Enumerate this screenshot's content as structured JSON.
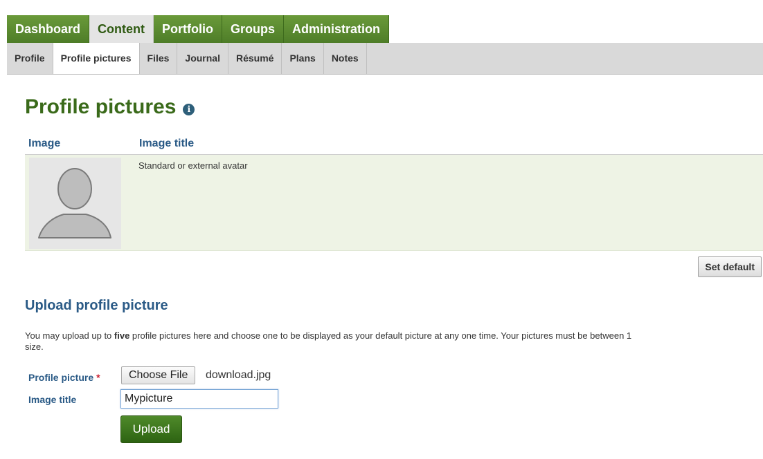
{
  "nav": {
    "main_tabs": [
      "Dashboard",
      "Content",
      "Portfolio",
      "Groups",
      "Administration"
    ],
    "main_selected": "Content",
    "sub_tabs": [
      "Profile",
      "Profile pictures",
      "Files",
      "Journal",
      "Résumé",
      "Plans",
      "Notes"
    ],
    "sub_selected": "Profile pictures"
  },
  "page": {
    "title": "Profile pictures",
    "info_icon": "i"
  },
  "table": {
    "headers": {
      "image": "Image",
      "image_title": "Image title"
    },
    "rows": [
      {
        "title": "Standard or external avatar"
      }
    ]
  },
  "set_default_label": "Set default",
  "upload": {
    "heading": "Upload profile picture",
    "desc_prefix": "You may upload up to ",
    "desc_bold": "five",
    "desc_suffix": " profile pictures here and choose one to be displayed as your default picture at any one time. Your pictures must be between 1",
    "desc_line2": "size.",
    "profile_picture_label": "Profile picture",
    "required_mark": "*",
    "choose_file_label": "Choose File",
    "file_name": "download.jpg",
    "image_title_label": "Image title",
    "image_title_value": "Mypicture",
    "upload_label": "Upload"
  },
  "colors": {
    "nav_green": "#5a8c30",
    "heading_green": "#3a6a1a",
    "heading_blue": "#2a5a86",
    "row_bg": "#eef3e5"
  }
}
